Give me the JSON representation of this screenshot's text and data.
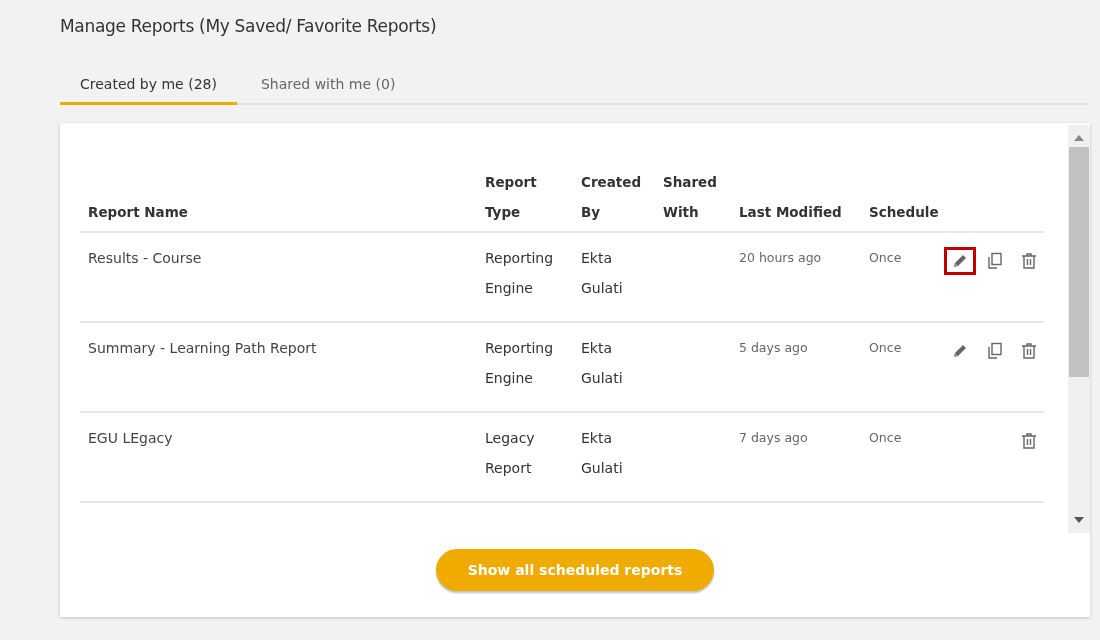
{
  "page_title": "Manage Reports (My Saved/ Favorite Reports)",
  "tabs": [
    {
      "label": "Created by me (28)",
      "selected": true
    },
    {
      "label": "Shared with me (0)",
      "selected": false
    }
  ],
  "table": {
    "columns": [
      [
        "Report Name"
      ],
      [
        "Report",
        "Type"
      ],
      [
        "Created",
        "By"
      ],
      [
        "Shared",
        "With"
      ],
      [
        "Last Modified"
      ],
      [
        "Schedule"
      ]
    ],
    "rows": [
      {
        "name": "Results - Course",
        "type": [
          "Reporting",
          "Engine"
        ],
        "created_by": [
          "Ekta",
          "Gulati"
        ],
        "last_modified": "20 hours ago",
        "schedule": "Once",
        "actions": [
          {
            "kind": "edit",
            "highlighted": true
          },
          {
            "kind": "copy",
            "highlighted": false
          },
          {
            "kind": "delete",
            "highlighted": false
          }
        ]
      },
      {
        "name": "Summary - Learning Path Report",
        "type": [
          "Reporting",
          "Engine"
        ],
        "created_by": [
          "Ekta",
          "Gulati"
        ],
        "last_modified": "5 days ago",
        "schedule": "Once",
        "actions": [
          {
            "kind": "edit",
            "highlighted": false
          },
          {
            "kind": "copy",
            "highlighted": false
          },
          {
            "kind": "delete",
            "highlighted": false
          }
        ]
      },
      {
        "name": "EGU LEgacy",
        "type": [
          "Legacy",
          "Report"
        ],
        "created_by": [
          "Ekta",
          "Gulati"
        ],
        "last_modified": "7 days ago",
        "schedule": "Once",
        "actions": [
          {
            "kind": "delete",
            "highlighted": false
          }
        ]
      }
    ]
  },
  "button": "Show all scheduled reports"
}
